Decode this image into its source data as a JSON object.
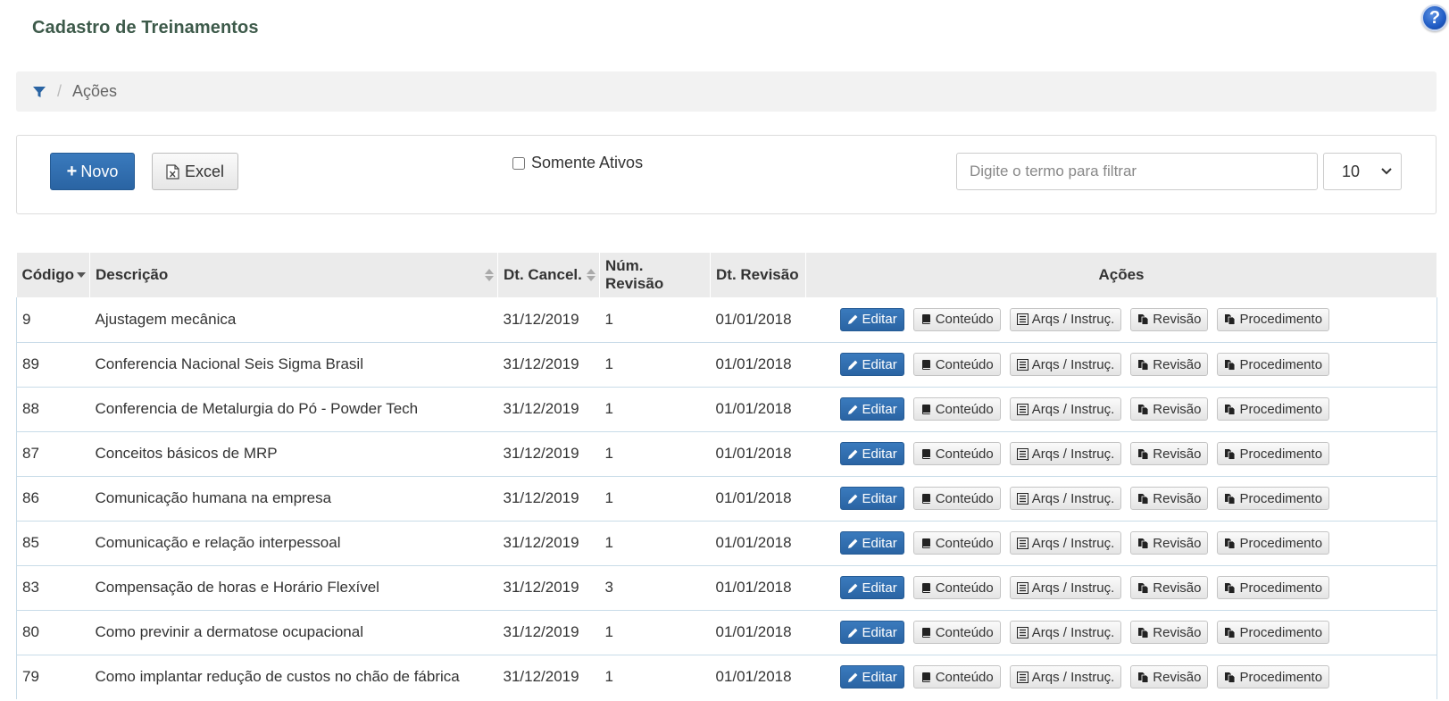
{
  "page": {
    "title": "Cadastro de Treinamentos",
    "help_symbol": "?"
  },
  "breadcrumb": {
    "current": "Ações",
    "separator": "/",
    "icon": "filter-icon"
  },
  "toolbar": {
    "new_label": "Novo",
    "new_icon": "+",
    "excel_label": "Excel",
    "only_active_label": "Somente Ativos",
    "only_active_checked": false,
    "search_placeholder": "Digite o termo para filtrar",
    "search_value": "",
    "page_size": "10"
  },
  "table": {
    "headers": {
      "codigo": "Código",
      "descricao": "Descrição",
      "dt_cancel": "Dt. Cancel.",
      "num_revisao": "Núm. Revisão",
      "dt_revisao": "Dt. Revisão",
      "acoes": "Ações"
    },
    "action_labels": {
      "editar": "Editar",
      "conteudo": "Conteúdo",
      "arqs": "Arqs / Instruç.",
      "revisao": "Revisão",
      "procedimento": "Procedimento"
    },
    "rows": [
      {
        "codigo": "9",
        "descricao": "Ajustagem mecânica",
        "dt_cancel": "31/12/2019",
        "num_revisao": "1",
        "dt_revisao": "01/01/2018"
      },
      {
        "codigo": "89",
        "descricao": "Conferencia Nacional Seis Sigma Brasil",
        "dt_cancel": "31/12/2019",
        "num_revisao": "1",
        "dt_revisao": "01/01/2018"
      },
      {
        "codigo": "88",
        "descricao": "Conferencia de Metalurgia do Pó - Powder Tech",
        "dt_cancel": "31/12/2019",
        "num_revisao": "1",
        "dt_revisao": "01/01/2018"
      },
      {
        "codigo": "87",
        "descricao": "Conceitos básicos de MRP",
        "dt_cancel": "31/12/2019",
        "num_revisao": "1",
        "dt_revisao": "01/01/2018"
      },
      {
        "codigo": "86",
        "descricao": "Comunicação humana na empresa",
        "dt_cancel": "31/12/2019",
        "num_revisao": "1",
        "dt_revisao": "01/01/2018"
      },
      {
        "codigo": "85",
        "descricao": "Comunicação e relação interpessoal",
        "dt_cancel": "31/12/2019",
        "num_revisao": "1",
        "dt_revisao": "01/01/2018"
      },
      {
        "codigo": "83",
        "descricao": "Compensação de horas e Horário Flexível",
        "dt_cancel": "31/12/2019",
        "num_revisao": "3",
        "dt_revisao": "01/01/2018"
      },
      {
        "codigo": "80",
        "descricao": "Como previnir a dermatose ocupacional",
        "dt_cancel": "31/12/2019",
        "num_revisao": "1",
        "dt_revisao": "01/01/2018"
      },
      {
        "codigo": "79",
        "descricao": "Como implantar redução de custos no chão de fábrica",
        "dt_cancel": "31/12/2019",
        "num_revisao": "1",
        "dt_revisao": "01/01/2018"
      }
    ]
  },
  "colors": {
    "primary": "#2a64a3",
    "title": "#3d5a4a",
    "row_border": "#c8dbe8",
    "header_bg": "#ebebeb"
  }
}
